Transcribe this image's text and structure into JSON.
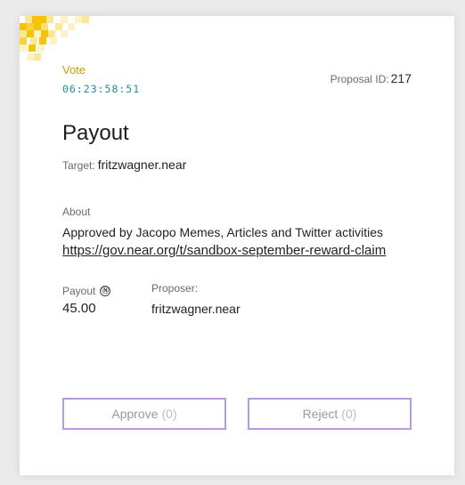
{
  "proposal": {
    "status": "Vote",
    "countdown": "06:23:58:51",
    "id_label": "Proposal ID:",
    "id_value": "217",
    "title": "Payout",
    "target_label": "Target:",
    "target_value": "fritzwagner.near",
    "about_label": "About",
    "about_text": "Approved by Jacopo Memes, Articles and Twitter activities",
    "about_link": "https://gov.near.org/t/sandbox-september-reward-claim",
    "payout_label": "Payout",
    "payout_icon": "near-icon",
    "payout_value": "45.00",
    "proposer_label": "Proposer:",
    "proposer_value": "fritzwagner.near"
  },
  "actions": {
    "approve_label": "Approve",
    "approve_count": "(0)",
    "reject_label": "Reject",
    "reject_count": "(0)"
  },
  "colors": {
    "status": "#c9a100",
    "countdown": "#1f8da3",
    "button_border": "#b99ae0",
    "pixel_gold": "#f5c400",
    "pixel_light": "#fbe79a"
  }
}
